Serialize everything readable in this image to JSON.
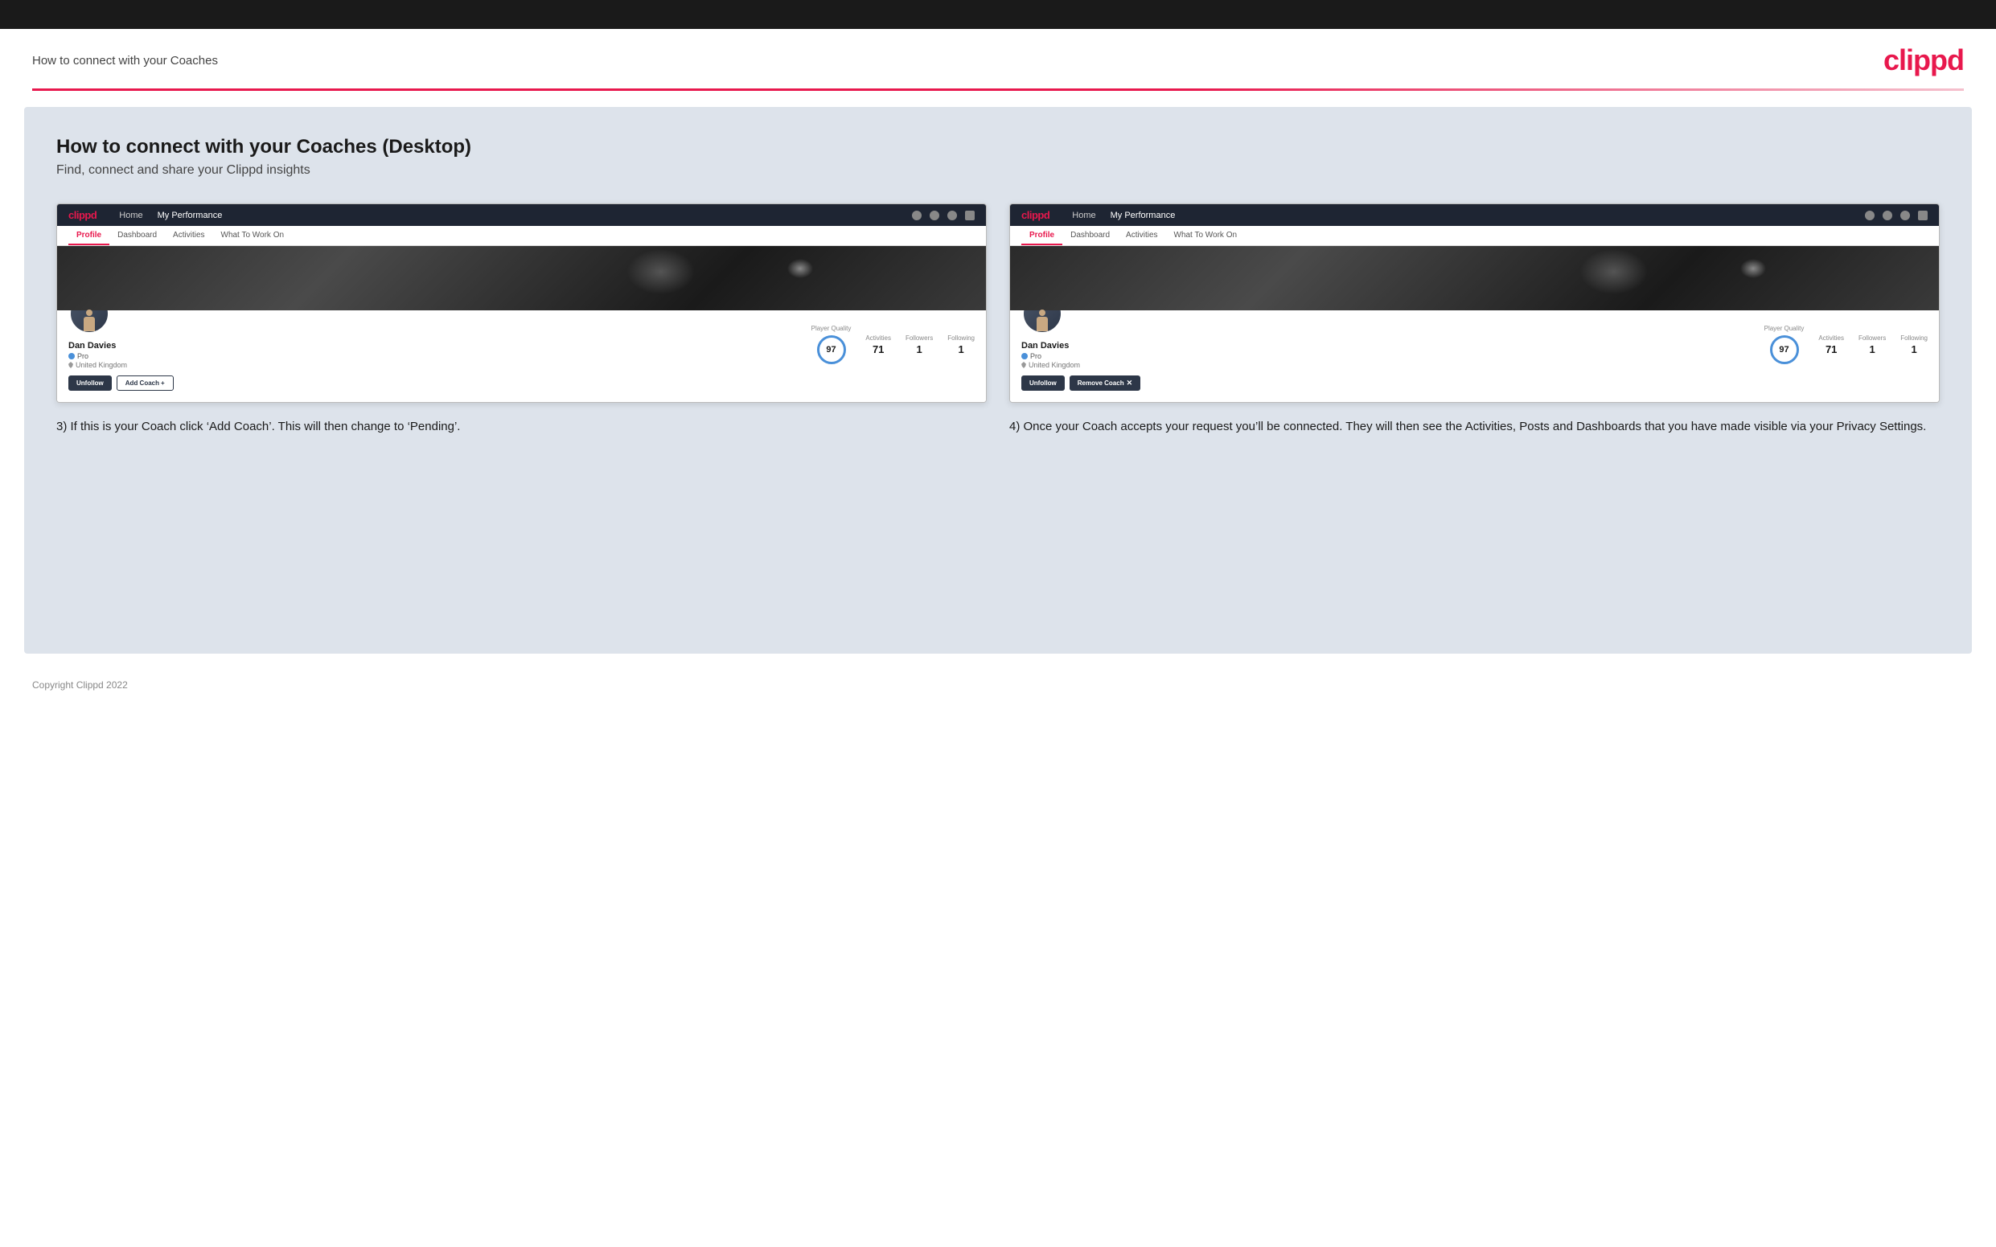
{
  "page": {
    "top_bar": "",
    "header": {
      "title": "How to connect with your Coaches",
      "logo": "clippd"
    },
    "section": {
      "title": "How to connect with your Coaches (Desktop)",
      "subtitle": "Find, connect and share your Clippd insights"
    },
    "screenshot_left": {
      "nav": {
        "logo": "clippd",
        "links": [
          "Home",
          "My Performance"
        ],
        "icons": [
          "search",
          "user",
          "settings",
          "avatar"
        ]
      },
      "tabs": [
        "Profile",
        "Dashboard",
        "Activities",
        "What To Work On"
      ],
      "active_tab": "Profile",
      "profile": {
        "name": "Dan Davies",
        "role": "Pro",
        "location": "United Kingdom",
        "quality_label": "Player Quality",
        "quality_value": "97",
        "stats": [
          {
            "label": "Activities",
            "value": "71"
          },
          {
            "label": "Followers",
            "value": "1"
          },
          {
            "label": "Following",
            "value": "1"
          }
        ],
        "buttons": [
          "Unfollow",
          "Add Coach"
        ]
      }
    },
    "screenshot_right": {
      "nav": {
        "logo": "clippd",
        "links": [
          "Home",
          "My Performance"
        ],
        "icons": [
          "search",
          "user",
          "settings",
          "avatar"
        ]
      },
      "tabs": [
        "Profile",
        "Dashboard",
        "Activities",
        "What To Work On"
      ],
      "active_tab": "Profile",
      "profile": {
        "name": "Dan Davies",
        "role": "Pro",
        "location": "United Kingdom",
        "quality_label": "Player Quality",
        "quality_value": "97",
        "stats": [
          {
            "label": "Activities",
            "value": "71"
          },
          {
            "label": "Followers",
            "value": "1"
          },
          {
            "label": "Following",
            "value": "1"
          }
        ],
        "buttons": [
          "Unfollow",
          "Remove Coach"
        ]
      }
    },
    "caption_left": "3) If this is your Coach click ‘Add Coach’. This will then change to ‘Pending’.",
    "caption_right": "4) Once your Coach accepts your request you’ll be connected. They will then see the Activities, Posts and Dashboards that you have made visible via your Privacy Settings.",
    "footer": "Copyright Clippd 2022"
  }
}
